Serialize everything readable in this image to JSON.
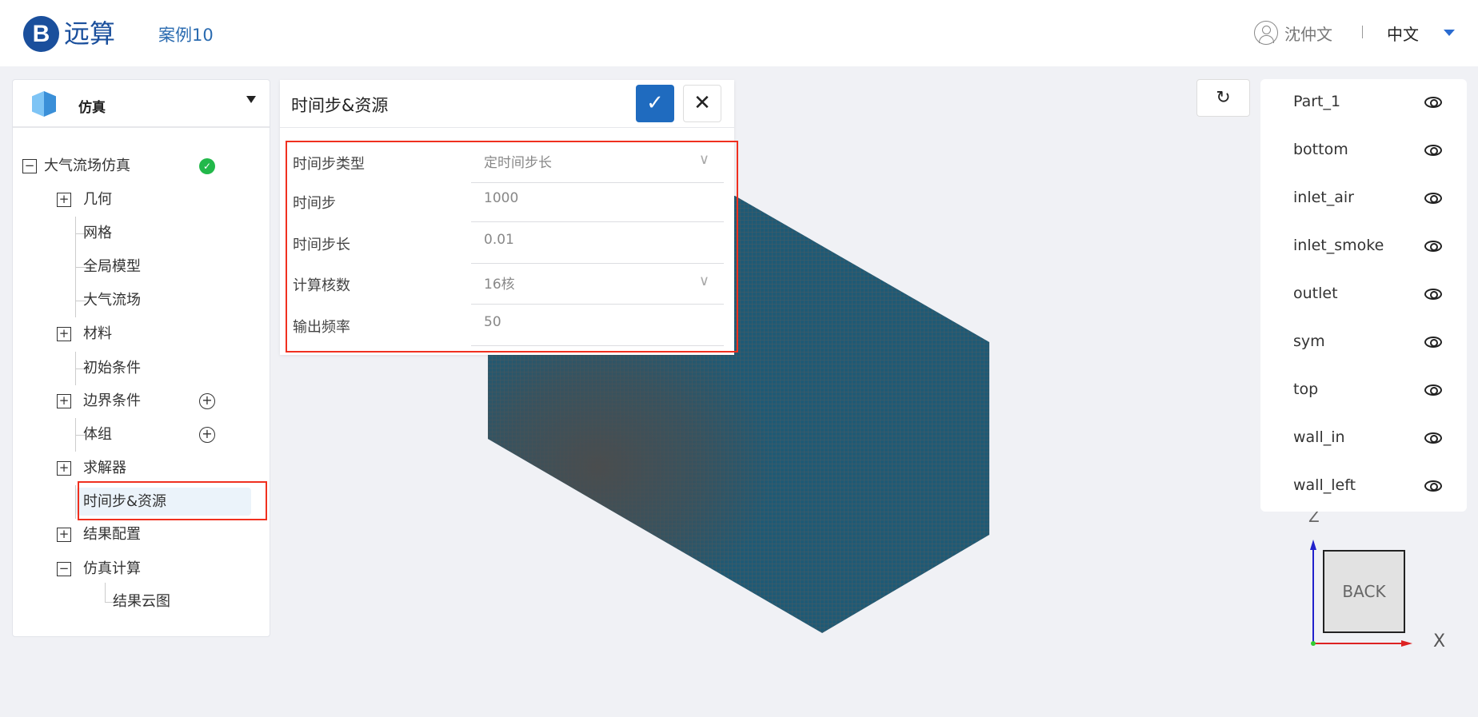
{
  "header": {
    "logo_text": "远算",
    "case_name": "案例10",
    "user_name": "沈仲文",
    "language": "中文"
  },
  "left_panel": {
    "title": "仿真",
    "tree": [
      {
        "label": "大气流场仿真",
        "toggle": "−",
        "status": "done"
      },
      {
        "label": "几何",
        "toggle": "+"
      },
      {
        "label": "网格"
      },
      {
        "label": "全局模型"
      },
      {
        "label": "大气流场"
      },
      {
        "label": "材料",
        "toggle": "+"
      },
      {
        "label": "初始条件"
      },
      {
        "label": "边界条件",
        "toggle": "+",
        "add": true
      },
      {
        "label": "体组",
        "add": true
      },
      {
        "label": "求解器",
        "toggle": "+"
      },
      {
        "label": "时间步&资源",
        "selected": true
      },
      {
        "label": "结果配置",
        "toggle": "+"
      },
      {
        "label": "仿真计算",
        "toggle": "−"
      },
      {
        "label": "结果云图"
      }
    ]
  },
  "form": {
    "title": "时间步&资源",
    "confirm_icon": "✓",
    "close_icon": "✕",
    "fields": [
      {
        "label": "时间步类型",
        "value": "定时间步长",
        "type": "select"
      },
      {
        "label": "时间步",
        "value": "1000",
        "type": "input"
      },
      {
        "label": "时间步长",
        "value": "0.01",
        "type": "input"
      },
      {
        "label": "计算核数",
        "value": "16核",
        "type": "select"
      },
      {
        "label": "输出频率",
        "value": "50",
        "type": "input"
      }
    ]
  },
  "parts": [
    "Part_1",
    "bottom",
    "inlet_air",
    "inlet_smoke",
    "outlet",
    "sym",
    "top",
    "wall_in",
    "wall_left"
  ],
  "axes": {
    "z": "Z",
    "x": "X",
    "face": "BACK"
  },
  "colors": {
    "accent": "#1f6bbf",
    "mesh": "#1f5a75",
    "highlight": "#f0301f",
    "success": "#22b84a"
  }
}
